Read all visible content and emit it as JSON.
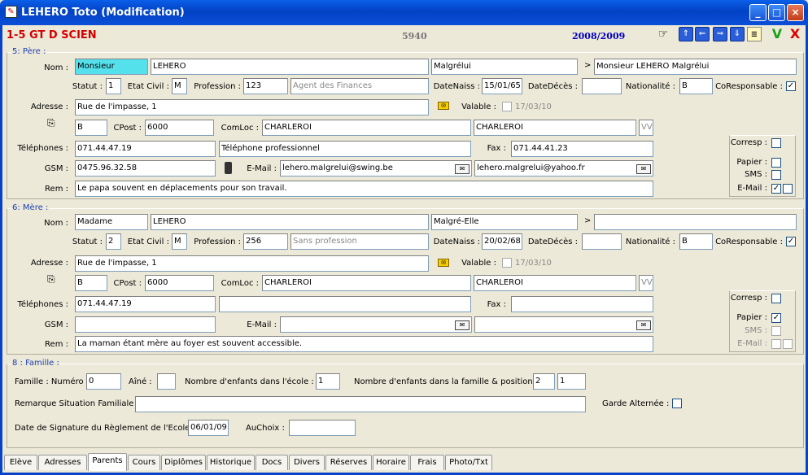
{
  "window": {
    "title": "LEHERO Toto (Modification)",
    "app_icon": "app-icon"
  },
  "header": {
    "class_label": "1-5 GT D SCIEN",
    "student_id": "5940",
    "school_year": "2008/2009"
  },
  "toolbar": {
    "nav_first": "first-record-icon",
    "nav_prev": "previous-record-icon",
    "nav_next": "next-record-icon",
    "nav_last": "last-record-icon",
    "ok": "V",
    "cancel": "X"
  },
  "pere": {
    "section_title": "5: Père :",
    "labels": {
      "nom": "Nom :",
      "statut": "Statut :",
      "etat_civil": "Etat Civil :",
      "profession": "Profession :",
      "datenaiss": "DateNaiss :",
      "datedeces": "DateDécès :",
      "nationalite": "Nationalité :",
      "coresponsable": "CoResponsable :",
      "adresse": "Adresse :",
      "valable": "Valable :",
      "cpost": "CPost :",
      "comloc": "ComLoc :",
      "telephones": "Téléphones :",
      "fax": "Fax :",
      "gsm": "GSM :",
      "email": "E-Mail :",
      "rem": "Rem :",
      "corresp": "Corresp :",
      "papier": "Papier :",
      "sms": "SMS :",
      "email_chk": "E-Mail :"
    },
    "civilite": "Monsieur",
    "nom": "LEHERO",
    "prenom": "Malgrélui",
    "arrow": ">",
    "nom_complet": "Monsieur LEHERO Malgrélui",
    "statut": "1",
    "etat_civil": "M",
    "profession_code": "123",
    "profession": "Agent des Finances",
    "date_naiss": "15/01/65",
    "date_deces": "",
    "nationalite": "B",
    "coresponsable": true,
    "adresse": "Rue de l'impasse, 1",
    "valable_date": "17/03/10",
    "pays": "B",
    "cpost": "6000",
    "comloc": "CHARLEROI",
    "localite": "CHARLEROI",
    "vv": "VV",
    "telephone": "071.44.47.19",
    "telephone2": "Téléphone professionnel",
    "fax": "071.44.41.23",
    "gsm": "0475.96.32.58",
    "email1": "lehero.malgrelui@swing.be",
    "email2": "lehero.malgrelui@yahoo.fr",
    "rem": "Le papa souvent en déplacements pour son travail.",
    "corresp": false,
    "papier": false,
    "sms": false,
    "email_chk1": true,
    "email_chk2": false
  },
  "mere": {
    "section_title": "6: Mère :",
    "labels": {
      "nom": "Nom :",
      "statut": "Statut :",
      "etat_civil": "Etat Civil :",
      "profession": "Profession :",
      "datenaiss": "DateNaiss :",
      "datedeces": "DateDécès :",
      "nationalite": "Nationalité :",
      "coresponsable": "CoResponsable :",
      "adresse": "Adresse :",
      "valable": "Valable :",
      "cpost": "CPost :",
      "comloc": "ComLoc :",
      "telephones": "Téléphones :",
      "fax": "Fax :",
      "gsm": "GSM :",
      "email": "E-Mail :",
      "rem": "Rem :",
      "corresp": "Corresp :",
      "papier": "Papier :",
      "sms": "SMS :",
      "email_chk": "E-Mail :"
    },
    "civilite": "Madame",
    "nom": "LEHERO",
    "prenom": "Malgré-Elle",
    "arrow": ">",
    "nom_complet": "",
    "statut": "2",
    "etat_civil": "M",
    "profession_code": "256",
    "profession": "Sans profession",
    "date_naiss": "20/02/68",
    "date_deces": "",
    "nationalite": "B",
    "coresponsable": true,
    "adresse": "Rue de l'impasse, 1",
    "valable_date": "17/03/10",
    "pays": "B",
    "cpost": "6000",
    "comloc": "CHARLEROI",
    "localite": "CHARLEROI",
    "vv": "VV",
    "telephone": "071.44.47.19",
    "telephone2": "",
    "fax": "",
    "gsm": "",
    "email1": "",
    "email2": "",
    "rem": "La maman étant mère au foyer est souvent accessible.",
    "corresp": false,
    "papier": true,
    "sms": false,
    "email_chk1": false,
    "email_chk2": false
  },
  "famille": {
    "section_title": "8 : Famille :",
    "labels": {
      "numero": "Famille : Numéro :",
      "aine": "Aîné :",
      "nb_ecole": "Nombre d'enfants dans l'école :",
      "nb_famille": "Nombre d'enfants dans la famille & position :",
      "remarque": "Remarque Situation Familiale :",
      "garde": "Garde Alternée :",
      "date_sig": "Date de Signature du Règlement de l'Ecole :",
      "auchoix": "AuChoix :"
    },
    "numero": "0",
    "aine": "",
    "nb_ecole": "1",
    "nb_famille": "2",
    "position": "1",
    "remarque": "",
    "garde_alternee": false,
    "date_signature": "06/01/09",
    "auchoix": ""
  },
  "tabs": [
    "Elève",
    "Adresses",
    "Parents",
    "Cours",
    "Diplômes",
    "Historique",
    "Docs",
    "Divers",
    "Réserves",
    "Horaire",
    "Frais",
    "Photo/Txt"
  ],
  "active_tab": "Parents"
}
